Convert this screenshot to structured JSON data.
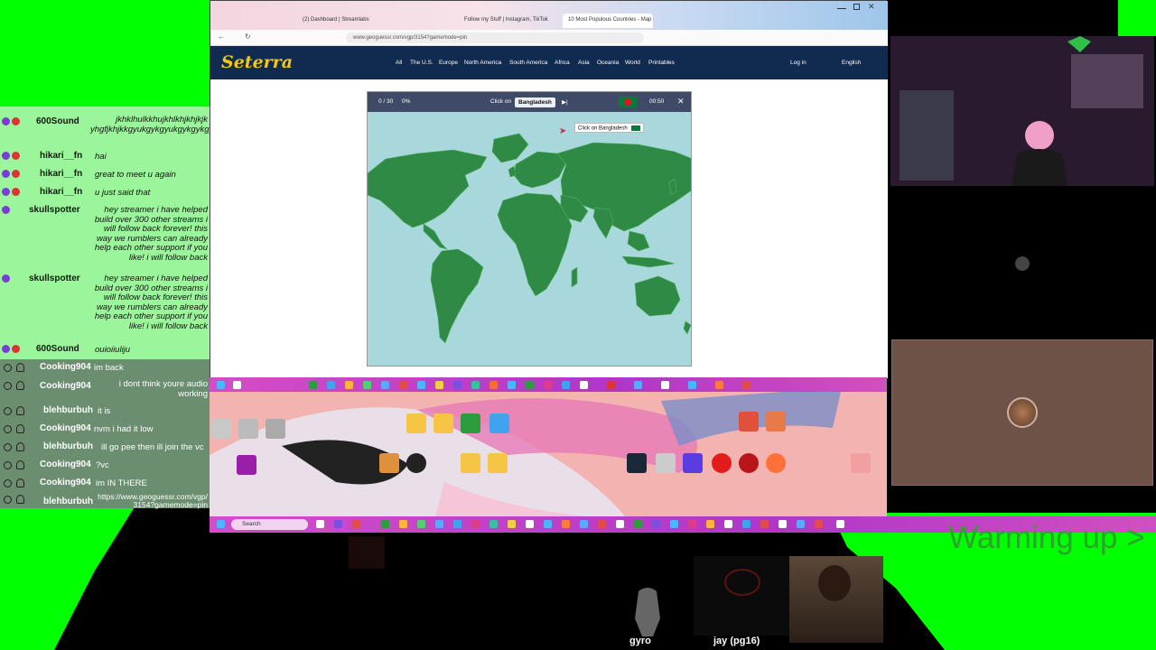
{
  "chat": {
    "messages": [
      {
        "user": "600Sound",
        "text": "jkhklhulkkhujkhlkhjkhjkjk yhgfjkhjkkgyukgykgyukgykgykgykgykg"
      },
      {
        "user": "hikari__fn",
        "text": "hai"
      },
      {
        "user": "hikari__fn",
        "text": "great to meet u again"
      },
      {
        "user": "hikari__fn",
        "text": "u just said that"
      },
      {
        "user": "skullspotter",
        "text": "hey streamer i have helped build over 300 other streams i will follow back forever! this way we rumblers can already help each other support if you like! i will follow back"
      },
      {
        "user": "skullspotter",
        "text": "hey streamer i have helped build over 300 other streams i will follow back forever! this way we rumblers can already help each other support if you like! i will follow back"
      },
      {
        "user": "600Sound",
        "text": "ouioiiuliju"
      }
    ],
    "lower_messages": [
      {
        "user": "Cooking904",
        "text": "im back"
      },
      {
        "user": "Cooking904",
        "text": "i dont think youre audio working"
      },
      {
        "user": "blehburbuh",
        "text": "it is"
      },
      {
        "user": "Cooking904",
        "text": "nvm i had it low"
      },
      {
        "user": "blehburbuh",
        "text": "ill go pee then ill join the vc"
      },
      {
        "user": "Cooking904",
        "text": "?vc"
      },
      {
        "user": "Cooking904",
        "text": "im IN THERE"
      },
      {
        "user": "blehburbuh",
        "text": "https://www.geoguessr.com/vgp/3154?gamemode=pin"
      }
    ]
  },
  "browser": {
    "tabs": [
      "(2) Dashboard | Streamlabs",
      "Follow my Stuff | Instagram, TikTok",
      "10 Most Populous Countries - Map"
    ],
    "url": "www.geoguessr.com/vgp/3154?gamemode=pin",
    "site": {
      "logo": "Seterra",
      "nav": [
        "All",
        "The U.S.",
        "Europe",
        "North America",
        "South America",
        "Africa",
        "Asia",
        "Oceania",
        "World",
        "Printables"
      ],
      "login": "Log in",
      "language": "English"
    },
    "game": {
      "progress": "0 / 30",
      "percent": "0%",
      "prompt": "Click on",
      "country": "Bangladesh",
      "timer": "00:50",
      "tooltip": "Click on Bangladesh"
    }
  },
  "taskbar": {
    "search_placeholder": "Search"
  },
  "cams": {
    "gyro_label": "gyro",
    "jay_label": "jay (pg16)"
  },
  "overlay": {
    "warming_text": "Warming up >"
  },
  "colors": {
    "green_screen": "#00ff00",
    "chat_bg": "#9bf59b",
    "site_nav": "#102a50",
    "map_sea": "#a9d8dc",
    "map_land": "#2f8a45",
    "taskbar": "#c244c8"
  }
}
